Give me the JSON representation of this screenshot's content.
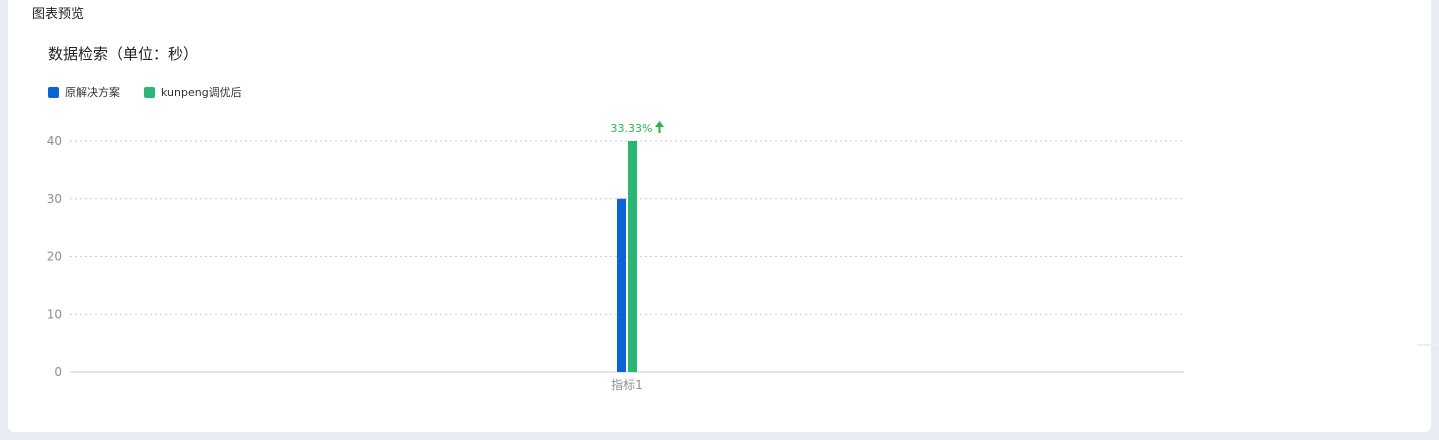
{
  "panel": {
    "title": "图表预览"
  },
  "chart_data": {
    "type": "bar",
    "title": "数据检索（单位：秒）",
    "xlabel": "",
    "ylabel": "",
    "categories": [
      "指标1"
    ],
    "series": [
      {
        "name": "原解决方案",
        "values": [
          30
        ],
        "color": "#0b63d6"
      },
      {
        "name": "kunpeng调优后",
        "values": [
          40
        ],
        "color": "#2bb673"
      }
    ],
    "ylim": [
      0,
      40
    ],
    "yticks": [
      0,
      10,
      20,
      30,
      40
    ],
    "grid": true,
    "legend_position": "top-left",
    "annotation": {
      "text": "33.33%",
      "icon": "arrow-up-icon",
      "color": "#2bb34f"
    }
  }
}
